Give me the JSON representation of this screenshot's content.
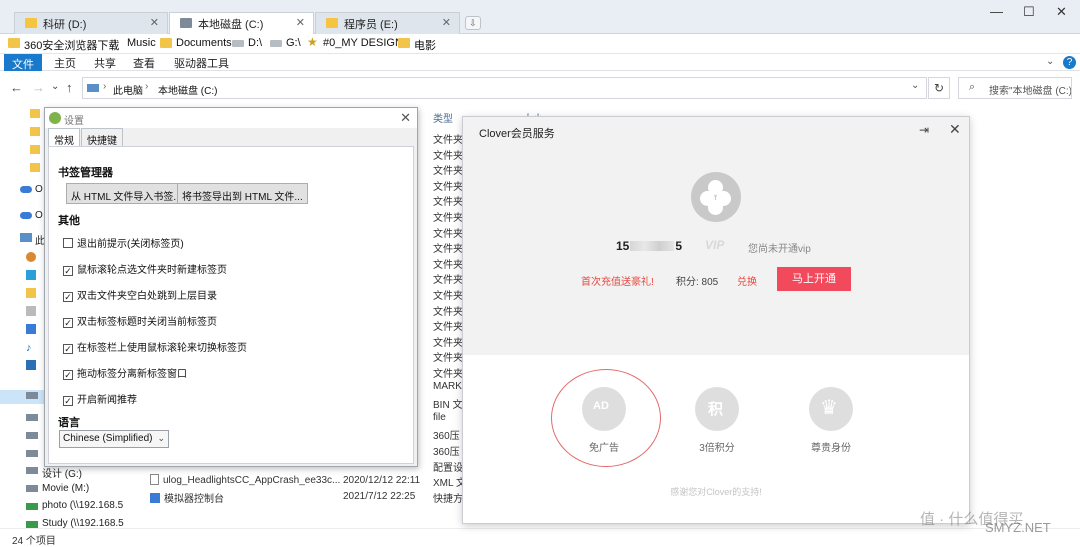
{
  "tabs": [
    {
      "label": "科研 (D:)",
      "active": false
    },
    {
      "label": "本地磁盘 (C:)",
      "active": true
    },
    {
      "label": "程序员 (E:)",
      "active": false
    }
  ],
  "window_controls": {
    "minimize": "—",
    "maximize": "☐",
    "close": "✕"
  },
  "favorites": [
    {
      "label": "360安全浏览器下载",
      "icon": "folder-icon"
    },
    {
      "label": "Music",
      "icon": "music-note-icon"
    },
    {
      "label": "Documents",
      "icon": "folder-icon"
    },
    {
      "label": "D:\\",
      "icon": "drive-icon"
    },
    {
      "label": "G:\\",
      "icon": "drive-icon"
    },
    {
      "label": "#0_MY DESIGN",
      "icon": "star-folder-icon"
    },
    {
      "label": "电影",
      "icon": "folder-icon"
    }
  ],
  "ribbon": {
    "file": "文件",
    "home": "主页",
    "share": "共享",
    "view": "查看",
    "drive_tools": "驱动器工具",
    "help": "?"
  },
  "address": {
    "part1": "此电脑",
    "part2": "本地磁盘 (C:)",
    "sep": "›",
    "dropdown": "⌄",
    "refresh": "↻"
  },
  "search": {
    "placeholder": "搜索\"本地磁盘 (C:)\""
  },
  "nav": {
    "back": "←",
    "forward": "→",
    "recent": "⌄",
    "up": "↑"
  },
  "left_nav": {
    "onedrive1": "O",
    "onedrive2": "O",
    "this_pc": "此",
    "drive_g": "设计 (G:)",
    "drive_m": "Movie (M:)",
    "net_photo": "photo (\\\\192.168.5",
    "net_study": "Study (\\\\192.168.5"
  },
  "columns": {
    "type": "类型",
    "size": "大小"
  },
  "type_column": [
    "文件夹",
    "文件夹",
    "文件夹",
    "文件夹",
    "文件夹",
    "文件夹",
    "文件夹",
    "文件夹",
    "文件夹",
    "文件夹",
    "文件夹",
    "文件夹",
    "文件夹",
    "文件夹",
    "文件夹",
    "文件夹",
    "MARKE",
    "BIN 文",
    "file",
    "360压",
    "360压",
    "配置设",
    "XML 文",
    "快捷方"
  ],
  "files": [
    {
      "name": "ulog_HeadlightsCC_AppCrash_ee33c...",
      "date": "2020/12/12 22:11"
    },
    {
      "name": "模拟器控制台",
      "date": "2021/7/12 22:25"
    }
  ],
  "status": {
    "count": "24 个项目"
  },
  "settings": {
    "title": "设置",
    "close": "✕",
    "tab_general": "常规",
    "tab_shortcuts": "快捷键",
    "bookmark_heading": "书签管理器",
    "import_btn": "从 HTML 文件导入书签...",
    "export_btn": "将书签导出到 HTML 文件...",
    "other_heading": "其他",
    "options": [
      {
        "label": "退出前提示(关闭标签页)",
        "checked": false
      },
      {
        "label": "鼠标滚轮点选文件夹时新建标签页",
        "checked": true
      },
      {
        "label": "双击文件夹空白处跳到上层目录",
        "checked": true
      },
      {
        "label": "双击标签标题时关闭当前标签页",
        "checked": true
      },
      {
        "label": "在标签栏上使用鼠标滚轮来切换标签页",
        "checked": true
      },
      {
        "label": "拖动标签分离新标签窗口",
        "checked": true
      },
      {
        "label": "开启新闻推荐",
        "checked": true
      }
    ],
    "language_heading": "语言",
    "language_value": "Chinese (Simplified)",
    "check_mark": "✓"
  },
  "clover": {
    "title": "Clover会员服务",
    "exit_icon": "⇥",
    "close": "✕",
    "user_prefix": "15",
    "user_suffix": "5",
    "vip_badge": "VIP",
    "vip_status": "您尚未开通vip",
    "promo": "首次充值送豪礼!",
    "points": "积分: 805",
    "exchange": "兑换",
    "open_btn": "马上开通",
    "perks": [
      {
        "label": "免广告",
        "icon": "no-ads-icon",
        "glyph": "AD"
      },
      {
        "label": "3倍积分",
        "icon": "points-icon",
        "glyph": "积"
      },
      {
        "label": "尊贵身份",
        "icon": "crown-icon",
        "glyph": "♛"
      }
    ],
    "thanks": "感谢您对Clover的支持!"
  },
  "watermark": {
    "text1": "值 · 什么值得买",
    "text2": "SMYZ.NET"
  },
  "colors": {
    "accent_blue": "#1979ca",
    "open_btn": "#f2495c",
    "promo_red": "#e8493f"
  }
}
